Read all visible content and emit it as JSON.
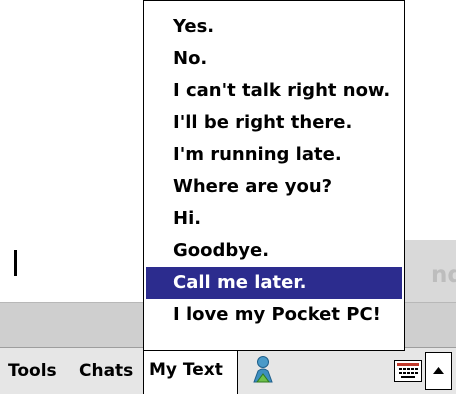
{
  "compose": {
    "send_label": "nd"
  },
  "menu_bar": {
    "tools_label": "Tools",
    "chats_label": "Chats",
    "mytext_label": "My Text",
    "user_icon": "user-icon",
    "keyboard_icon": "keyboard-icon",
    "arrow_icon": "triangle-up-icon"
  },
  "my_text_menu": {
    "selected_index": 8,
    "items": [
      {
        "label": "Yes."
      },
      {
        "label": "No."
      },
      {
        "label": "I can't talk right now."
      },
      {
        "label": "I'll be right there."
      },
      {
        "label": "I'm running late."
      },
      {
        "label": "Where are you?"
      },
      {
        "label": "Hi."
      },
      {
        "label": "Goodbye."
      },
      {
        "label": "Call me later."
      },
      {
        "label": "I love my Pocket PC!"
      }
    ]
  },
  "colors": {
    "selection": "#2c2c8e",
    "menu_bar": "#e6e6e6",
    "gray_bar": "#cfcfcf"
  }
}
